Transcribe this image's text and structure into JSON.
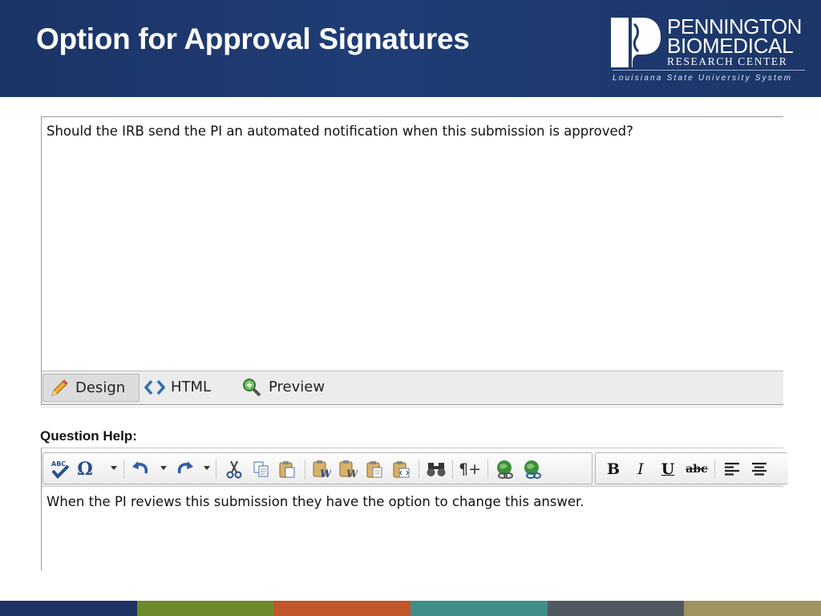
{
  "slide": {
    "title": "Option for Approval Signatures"
  },
  "logo": {
    "line1": "PENNINGTON",
    "line2": "BIOMEDICAL",
    "line3": "RESEARCH CENTER",
    "line4": "Louisiana State University System"
  },
  "question_editor": {
    "content": "Should the IRB send the PI an automated notification when this submission is approved?",
    "tabs": [
      {
        "label": "Design",
        "icon": "pencil-icon",
        "active": true
      },
      {
        "label": "HTML",
        "icon": "code-brackets-icon",
        "active": false
      },
      {
        "label": "Preview",
        "icon": "magnifier-icon",
        "active": false
      }
    ]
  },
  "help_section": {
    "label": "Question Help:"
  },
  "help_editor": {
    "content": "When the PI reviews this submission they have the option to change this answer.",
    "toolbar_icons": [
      "spellcheck-icon",
      "special-char-icon",
      "undo-icon",
      "redo-icon",
      "cut-icon",
      "copy-icon",
      "paste-icon",
      "paste-word-icon",
      "paste-plain-word-icon",
      "paste-text-icon",
      "paste-html-icon",
      "find-icon",
      "paragraph-icon",
      "insert-link-icon",
      "remove-link-icon",
      "bold-icon",
      "italic-icon",
      "underline-icon",
      "strikethrough-icon",
      "align-left-icon",
      "align-center-icon"
    ],
    "format_labels": {
      "bold": "B",
      "italic": "I",
      "underline": "U",
      "strike": "abc",
      "special_char": "Ω",
      "paragraph": "¶+"
    }
  },
  "colors": {
    "header_bg": "#1b3466",
    "stripe": [
      "#1d3364",
      "#6e8a2a",
      "#c1572a",
      "#3f8e89",
      "#505861",
      "#a09360"
    ]
  }
}
